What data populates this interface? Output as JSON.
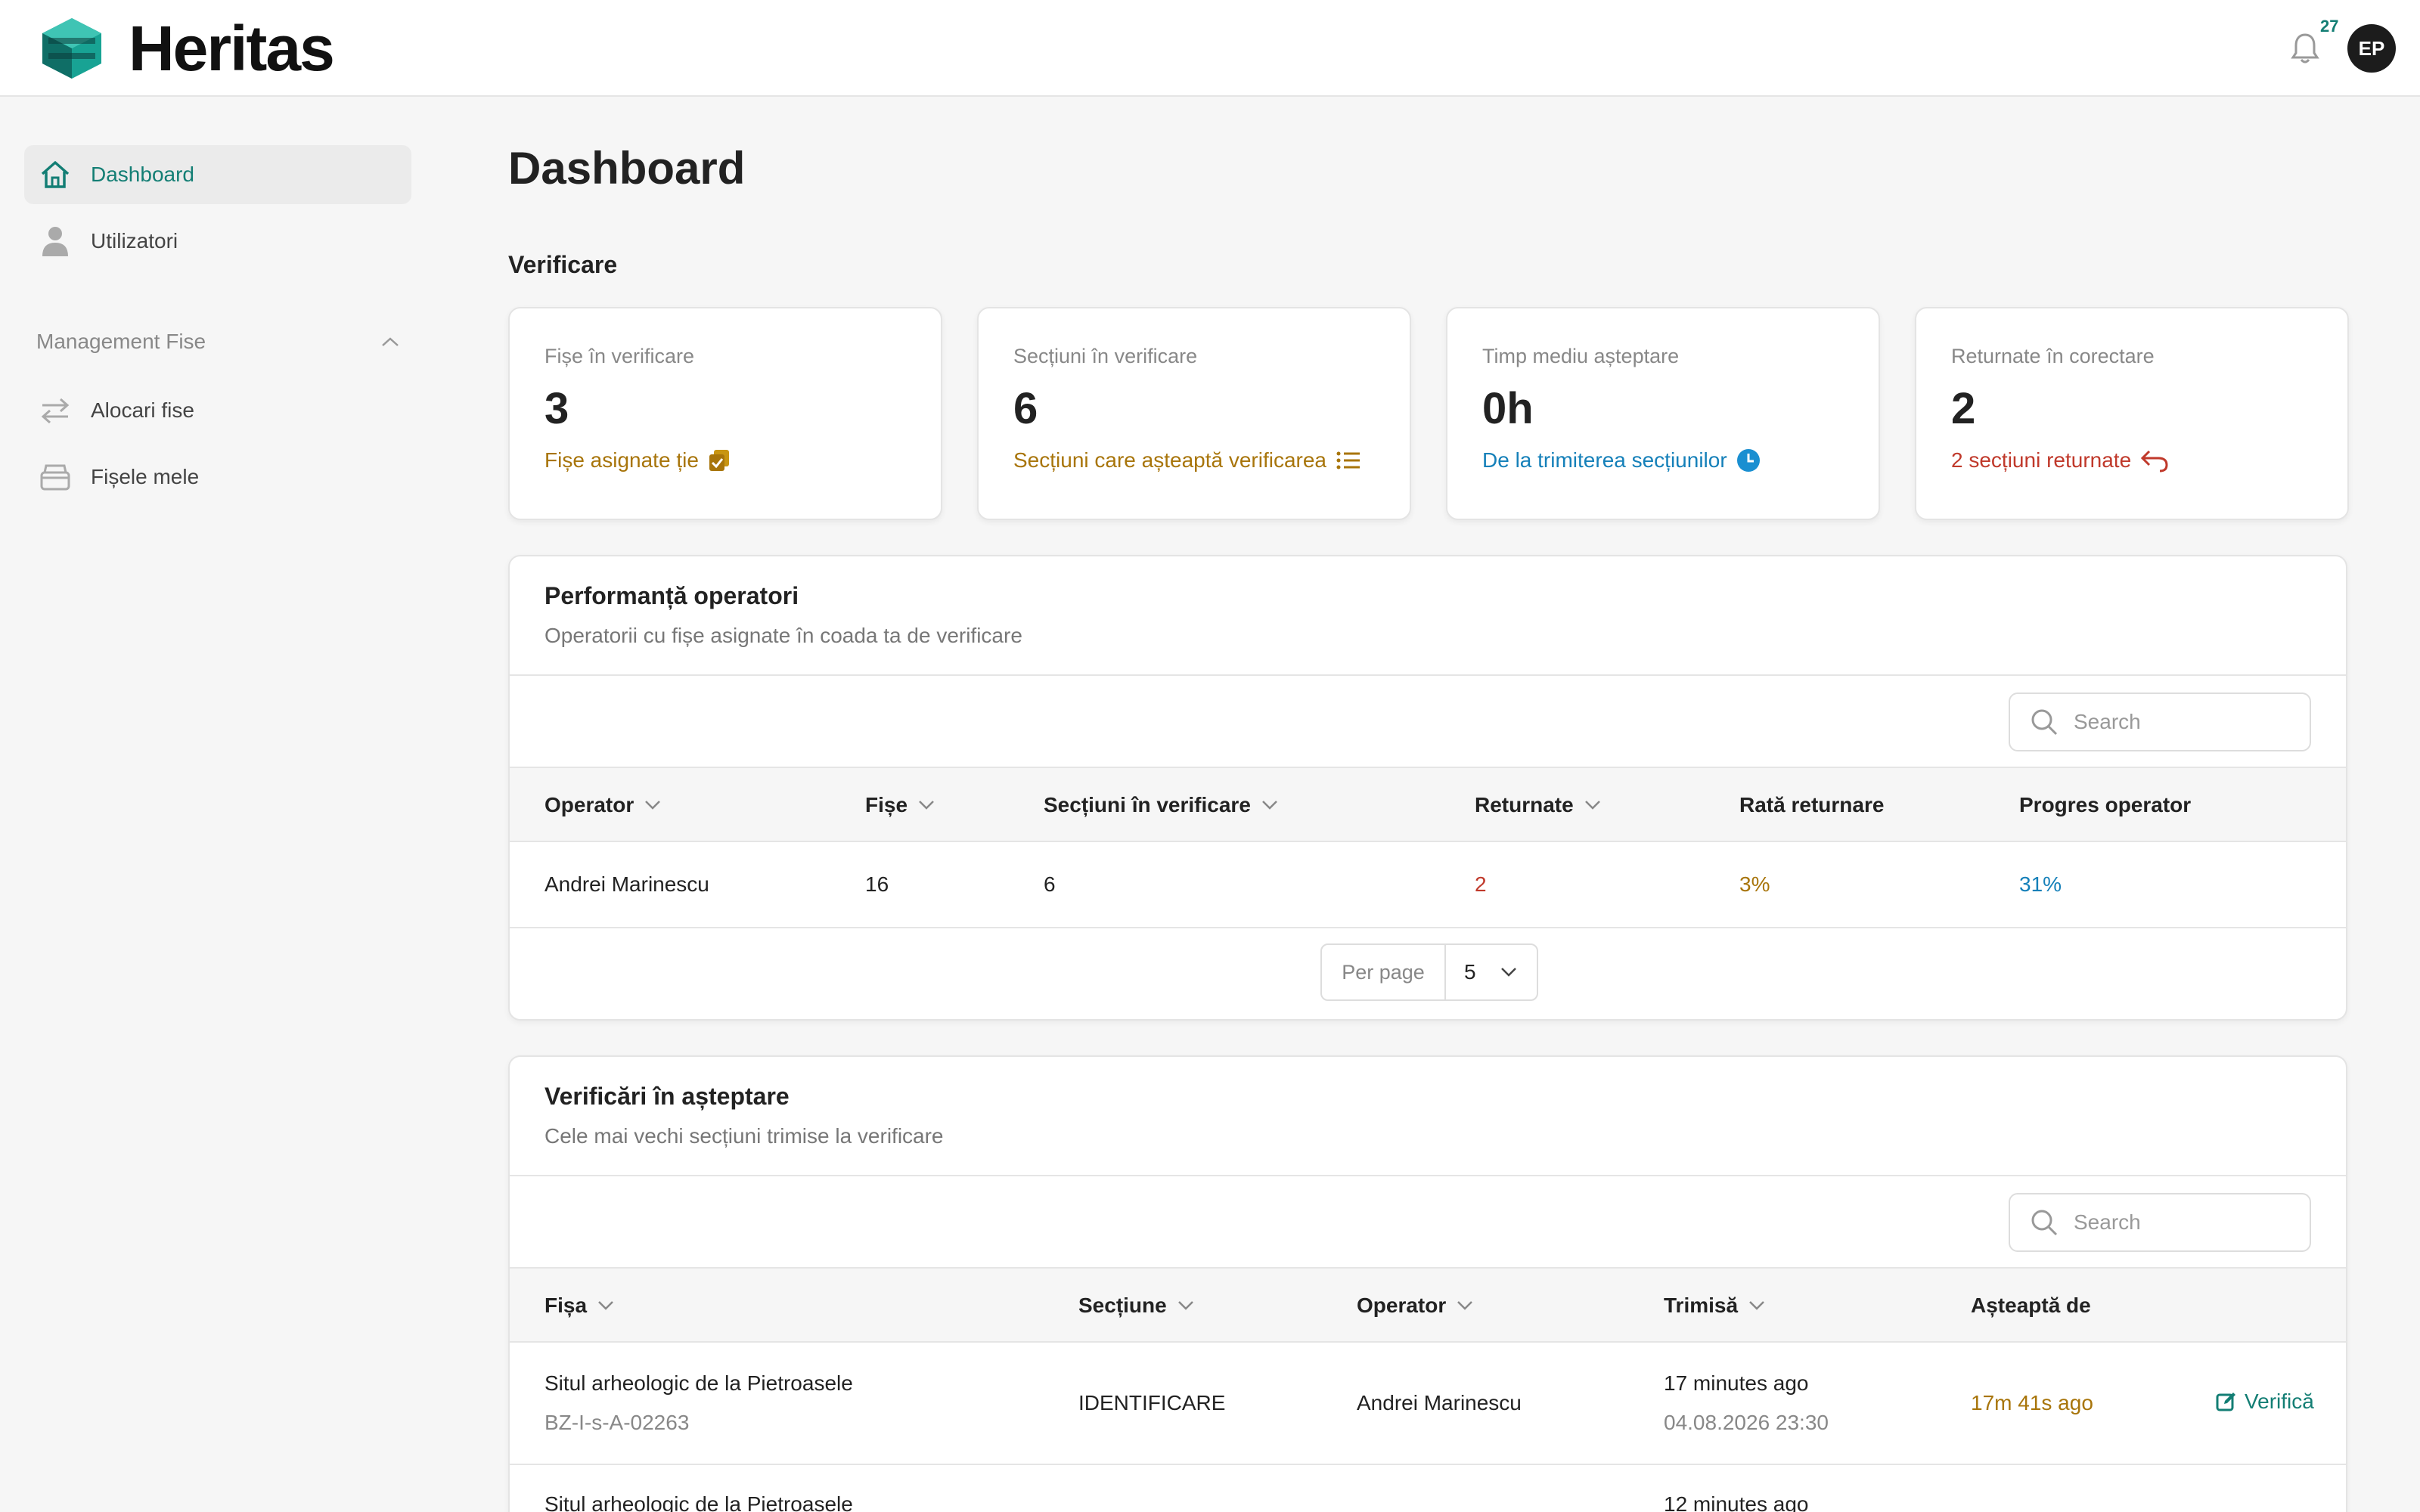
{
  "app": {
    "brand": "Heritas",
    "notification_count": "27",
    "user_initials": "EP"
  },
  "sidebar": {
    "items": [
      {
        "label": "Dashboard",
        "icon": "home-icon"
      },
      {
        "label": "Utilizatori",
        "icon": "user-icon"
      }
    ],
    "section": {
      "label": "Management Fise",
      "icon": "chevron-up-icon"
    },
    "section_items": [
      {
        "label": "Alocari fise",
        "icon": "swap-arrows-icon"
      },
      {
        "label": "Fișele mele",
        "icon": "archive-box-icon"
      }
    ]
  },
  "page": {
    "title": "Dashboard",
    "section_title": "Verificare"
  },
  "stats": [
    {
      "label": "Fișe în verificare",
      "value": "3",
      "note": "Fișe asignate ție",
      "color": "#a8750b",
      "icon": "copy-check-icon"
    },
    {
      "label": "Secțiuni în verificare",
      "value": "6",
      "note": "Secțiuni care așteaptă verificarea",
      "color": "#a8750b",
      "icon": "list-icon"
    },
    {
      "label": "Timp mediu așteptare",
      "value": "0h",
      "note": "De la trimiterea secțiunilor",
      "color": "#1580b9",
      "icon": "clock-icon"
    },
    {
      "label": "Returnate în corectare",
      "value": "2",
      "note": "2 secțiuni returnate",
      "color": "#c0392b",
      "icon": "return-arrow-icon"
    }
  ],
  "performance": {
    "title": "Performanță operatori",
    "subtitle": "Operatorii cu fișe asignate în coada ta de verificare",
    "search_placeholder": "Search",
    "columns": [
      "Operator",
      "Fișe",
      "Secțiuni în verificare",
      "Returnate",
      "Rată returnare",
      "Progres operator"
    ],
    "rows": [
      {
        "operator": "Andrei Marinescu",
        "fise": "16",
        "sectiuni": "6",
        "returnate": "2",
        "rata": "3%",
        "progres": "31%"
      }
    ],
    "per_page_label": "Per page",
    "per_page_value": "5"
  },
  "pending": {
    "title": "Verificări în așteptare",
    "subtitle": "Cele mai vechi secțiuni trimise la verificare",
    "search_placeholder": "Search",
    "columns": [
      "Fișa",
      "Secțiune",
      "Operator",
      "Trimisă",
      "Așteaptă de"
    ],
    "rows": [
      {
        "fisa": "Situl arheologic de la Pietroasele",
        "code": "BZ-I-s-A-02263",
        "sectiune": "IDENTIFICARE",
        "operator": "Andrei Marinescu",
        "trimisa": "17 minutes ago",
        "trimisa_date": "04.08.2026 23:30",
        "asteapta": "17m 41s ago",
        "action": "Verifică"
      },
      {
        "fisa": "Situl arheologic de la Pietroasele",
        "trimisa": "12 minutes ago"
      }
    ]
  }
}
